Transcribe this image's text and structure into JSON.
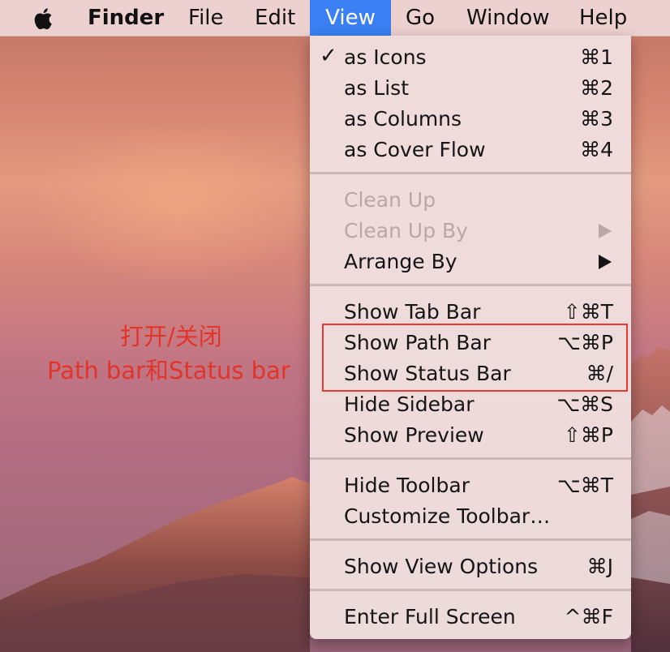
{
  "menubar": {
    "app_name": "Finder",
    "items": [
      "File",
      "Edit",
      "View",
      "Go",
      "Window",
      "Help"
    ],
    "active_item": "View"
  },
  "view_menu": {
    "groups": [
      [
        {
          "label": "as Icons",
          "shortcut": "⌘1",
          "checked": true
        },
        {
          "label": "as List",
          "shortcut": "⌘2"
        },
        {
          "label": "as Columns",
          "shortcut": "⌘3"
        },
        {
          "label": "as Cover Flow",
          "shortcut": "⌘4"
        }
      ],
      [
        {
          "label": "Clean Up",
          "disabled": true
        },
        {
          "label": "Clean Up By",
          "disabled": true,
          "submenu": true
        },
        {
          "label": "Arrange By",
          "submenu": true
        }
      ],
      [
        {
          "label": "Show Tab Bar",
          "shortcut": "⇧⌘T"
        },
        {
          "label": "Show Path Bar",
          "shortcut": "⌥⌘P"
        },
        {
          "label": "Show Status Bar",
          "shortcut": "⌘/"
        },
        {
          "label": "Hide Sidebar",
          "shortcut": "⌥⌘S"
        },
        {
          "label": "Show Preview",
          "shortcut": "⇧⌘P"
        }
      ],
      [
        {
          "label": "Hide Toolbar",
          "shortcut": "⌥⌘T"
        },
        {
          "label": "Customize Toolbar…"
        }
      ],
      [
        {
          "label": "Show View Options",
          "shortcut": "⌘J"
        }
      ],
      [
        {
          "label": "Enter Full Screen",
          "shortcut": "^⌘F"
        }
      ]
    ]
  },
  "annotation": {
    "line1": "打开/关闭",
    "line2": "Path bar和Status bar",
    "color": "#e3342a"
  },
  "icons": {
    "apple": "apple-logo-icon",
    "check": "checkmark-icon",
    "submenu": "submenu-arrow-icon"
  },
  "colors": {
    "active_menu": "#3a80f4",
    "disabled_text": "#b8a8a8"
  }
}
